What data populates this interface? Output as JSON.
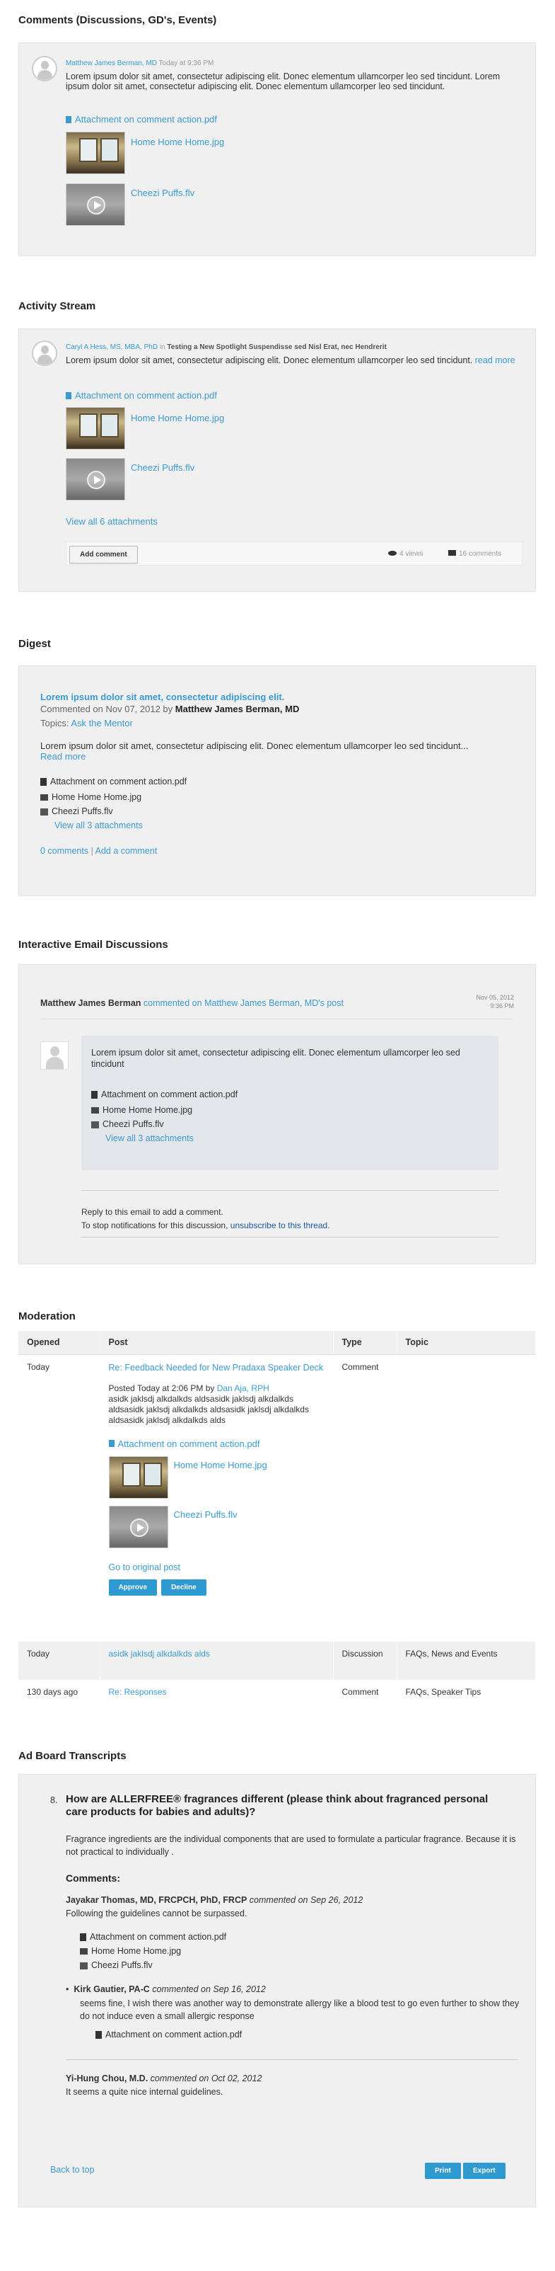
{
  "comments": {
    "title": "Comments (Discussions, GD's, Events)",
    "author": "Matthew James Berman, MD",
    "time": "Today at 9:36 PM",
    "text": "Lorem ipsum dolor sit amet, consectetur adipiscing elit. Donec elementum ullamcorper leo sed tincidunt. Lorem ipsum dolor sit amet, consectetur adipiscing elit. Donec elementum ullamcorper leo sed tincidunt.",
    "attachment": "Attachment on comment action.pdf",
    "image": "Home Home Home.jpg",
    "video": "Cheezi Puffs.flv"
  },
  "activity": {
    "title": "Activity Stream",
    "author": "Caryl A Hess, MS, MBA, PhD",
    "in": "in",
    "target": "Testing a New Spotlight Suspendisse sed Nisl Erat, nec Hendrerit",
    "text": "Lorem ipsum dolor sit amet, consectetur adipiscing elit. Donec elementum ullamcorper leo sed tincidunt.",
    "read_more": "read more",
    "attachment": "Attachment on comment action.pdf",
    "image": "Home Home Home.jpg",
    "video": "Cheezi Puffs.flv",
    "view_all": "View all 6 attachments",
    "add_comment": "Add comment",
    "views": "4 views",
    "comments": "16 comments"
  },
  "digest": {
    "title": "Digest",
    "headline": "Lorem ipsum dolor sit amet, consectetur adipiscing elit.",
    "commented": "Commented on Nov 07, 2012 by",
    "author": "Matthew James Berman, MD",
    "topics_label": "Topics:",
    "topic": "Ask the Mentor",
    "text": "Lorem ipsum dolor sit amet, consectetur adipiscing elit. Donec elementum ullamcorper leo sed tincidunt...",
    "read_more": "Read more",
    "att1": "Attachment on comment action.pdf",
    "att2": "Home Home Home.jpg",
    "att3": "Cheezi Puffs.flv",
    "view_all": "View all 3 attachments",
    "comments": "0 comments",
    "sep": "|",
    "add": "Add a comment"
  },
  "email": {
    "title": "Interactive Email Discussions",
    "author": "Matthew James Berman",
    "action": "commented on Matthew James Berman, MD's post",
    "date": "Nov 05, 2012",
    "time": "9:36 PM",
    "text": "Lorem ipsum dolor sit amet, consectetur adipiscing elit. Donec elementum ullamcorper leo sed tincidunt",
    "att1": "Attachment on comment action.pdf",
    "att2": "Home Home Home.jpg",
    "att3": "Cheezi Puffs.flv",
    "view_all": "View all 3 attachments",
    "reply": "Reply to this email to add a comment.",
    "stop": "To stop notifications for this discussion,",
    "unsub": "unsubscribe to this thread."
  },
  "moderation": {
    "title": "Moderation",
    "headers": [
      "Opened",
      "Post",
      "Type",
      "Topic"
    ],
    "row1": {
      "opened": "Today",
      "post": "Re: Feedback Needed for New Pradaxa Speaker Deck",
      "posted": "Posted Today at 2:06 PM by",
      "by": "Dan Aja, RPH",
      "text": "asidk jaklsdj alkdalkds aldsasidk jaklsdj alkdalkds aldsasidk jaklsdj alkdalkds aldsasidk jaklsdj alkdalkds aldsasidk jaklsdj alkdalkds alds",
      "attachment": "Attachment on comment action.pdf",
      "image": "Home Home Home.jpg",
      "video": "Cheezi Puffs.flv",
      "goto": "Go to original post",
      "approve": "Approve",
      "decline": "Decline",
      "type": "Comment",
      "topic": ""
    },
    "row2": {
      "opened": "Today",
      "post": "asidk jaklsdj alkdalkds alds",
      "type": "Discussion",
      "topic": "FAQs, News and Events"
    },
    "row3": {
      "opened": "130 days ago",
      "post": "Re: Responses",
      "type": "Comment",
      "topic": "FAQs, Speaker Tips"
    }
  },
  "adboard": {
    "title": "Ad Board Transcripts",
    "num": "8.",
    "question": "How are ALLERFREE® fragrances different (please think about fragranced personal care products for babies and adults)?",
    "answer": "Fragrance ingredients are the individual components that are used to formulate a particular fragrance. Because it is not practical to individually .",
    "comments_label": "Comments:",
    "c1_author": "Jayakar Thomas, MD, FRCPCH, PhD, FRCP",
    "c1_meta": "commented on Sep 26, 2012",
    "c1_text": "Following the guidelines cannot be surpassed.",
    "c1_att1": "Attachment on comment action.pdf",
    "c1_att2": "Home Home Home.jpg",
    "c1_att3": "Cheezi Puffs.flv",
    "c2_author": "Kirk Gautier, PA-C",
    "c2_meta": "commented on Sep 16, 2012",
    "c2_text": "seems fine, I wish there was another way to demonstrate allergy like a blood test to go even further to show they do not induce even a small allergic response",
    "c2_att": "Attachment on comment action.pdf",
    "c3_author": "Yi-Hung Chou, M.D.",
    "c3_meta": "commented on Oct 02, 2012",
    "c3_text": "It seems a quite nice internal guidelines.",
    "back": "Back to top",
    "print": "Print",
    "export": "Export"
  }
}
